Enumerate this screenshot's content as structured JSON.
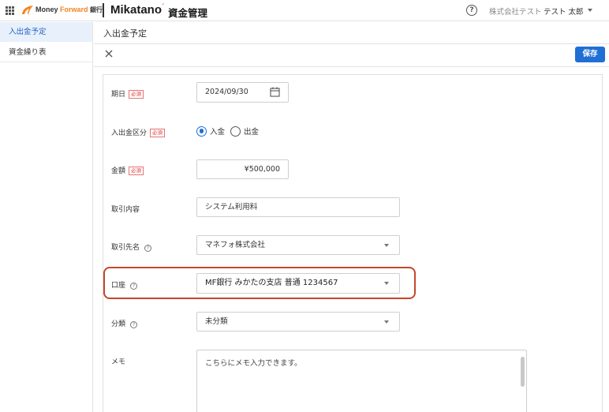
{
  "header": {
    "brand_money": "Money ",
    "brand_forward": "Forward",
    "brand_bank": "銀行",
    "app_name": "Mikatano",
    "app_accent": "´",
    "product": "資金管理",
    "help_glyph": "?",
    "company": "株式会社テスト",
    "user": "テスト 太郎",
    "icons": {
      "apps": "apps-grid-icon",
      "logo": "money-forward-logo-icon",
      "help": "help-icon",
      "user_menu": "caret-down-icon"
    }
  },
  "sidebar": {
    "items": [
      {
        "label": "入出金予定",
        "active": true
      },
      {
        "label": "資金繰り表",
        "active": false
      }
    ]
  },
  "main": {
    "title": "入出金予定",
    "save_label": "保存",
    "close_icon": "close-icon"
  },
  "form": {
    "required_badge": "必須",
    "help_glyph": "?",
    "date": {
      "label": "期日",
      "value": "2024/09/30",
      "icon": "calendar-icon"
    },
    "type": {
      "label": "入出金区分",
      "options": [
        "入金",
        "出金"
      ],
      "selected": "入金"
    },
    "amount": {
      "label": "金額",
      "value": "¥500,000"
    },
    "description": {
      "label": "取引内容",
      "value": "システム利用料"
    },
    "partner": {
      "label": "取引先名",
      "value": "マネフォ株式会社"
    },
    "account": {
      "label": "口座",
      "value": "MF銀行 みかたの支店 普通 1234567"
    },
    "category": {
      "label": "分類",
      "value": "未分類"
    },
    "memo": {
      "label": "メモ",
      "placeholder": "こちらにメモ入力できます。"
    }
  },
  "colors": {
    "accent_blue": "#1f6fd4",
    "highlight_red": "#c4482a",
    "brand_orange": "#f5821f",
    "sidebar_active_bg": "#e8f0fb"
  }
}
